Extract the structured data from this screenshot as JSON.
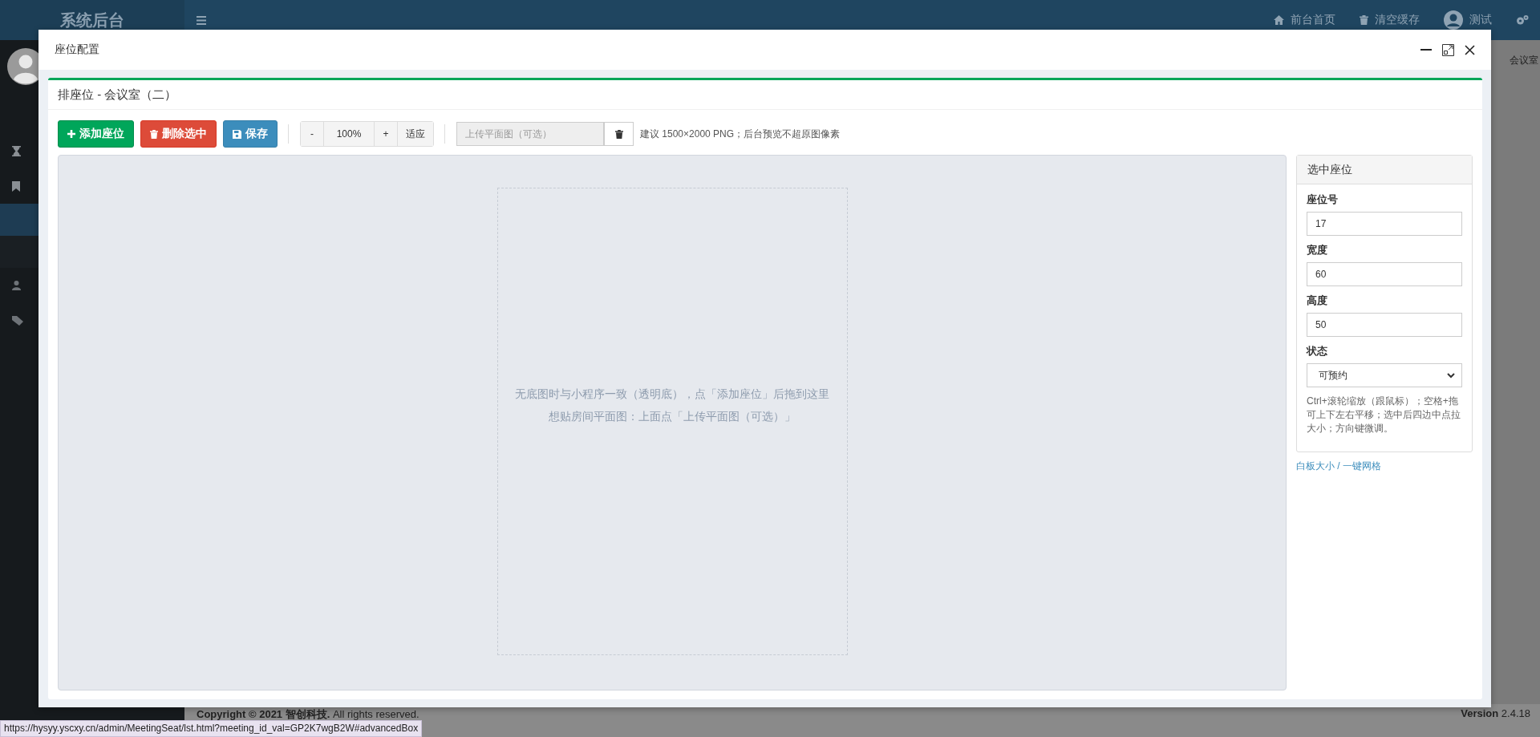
{
  "topbar": {
    "logo": "系统后台",
    "links": [
      {
        "label": "前台首页"
      },
      {
        "label": "清空缓存"
      }
    ],
    "user": "测试"
  },
  "behind_tab": "会议室",
  "footer": {
    "copyright": "**Copyright © 2021 智创科技.** All rights reserved.",
    "version": "**Version** 2.4.18"
  },
  "status_url": "https://hysyy.yscxy.cn/admin/MeetingSeat/lst.html?meeting_id_val=GP2K7wgB2W#advancedBox",
  "modal": {
    "title": "座位配置",
    "box_title": "排座位 - 会议室（二）",
    "toolbar": {
      "buttons": [
        {
          "label": "添加座位",
          "kind": "success"
        },
        {
          "label": "删除选中",
          "kind": "danger"
        },
        {
          "label": "保存",
          "kind": "primary"
        }
      ],
      "zoom": {
        "minus": "-",
        "value": "100%",
        "plus": "+",
        "fit": "适应"
      },
      "upload": {
        "placeholder": "上传平面图（可选）"
      },
      "hint": "建议 1500×2000 PNG；后台预览不超原图像素"
    },
    "canvas": {
      "lines": [
        "无底图时与小程序一致（透明底），点「添加座位」后拖到这里",
        "想贴房间平面图：上面点「上传平面图（可选）」"
      ]
    },
    "panel": {
      "title": "选中座位",
      "fields": [
        {
          "label": "座位号",
          "value": "17",
          "kind": "input"
        },
        {
          "label": "宽度",
          "value": "60",
          "kind": "input"
        },
        {
          "label": "高度",
          "value": "50",
          "kind": "input"
        },
        {
          "label": "状态",
          "value": "可预约",
          "kind": "select"
        }
      ],
      "help": "Ctrl+滚轮缩放（跟鼠标）；空格+拖可上下左右平移；选中后四边中点拉大小；方向键微调。",
      "link": "白板大小 / 一键网格"
    }
  }
}
